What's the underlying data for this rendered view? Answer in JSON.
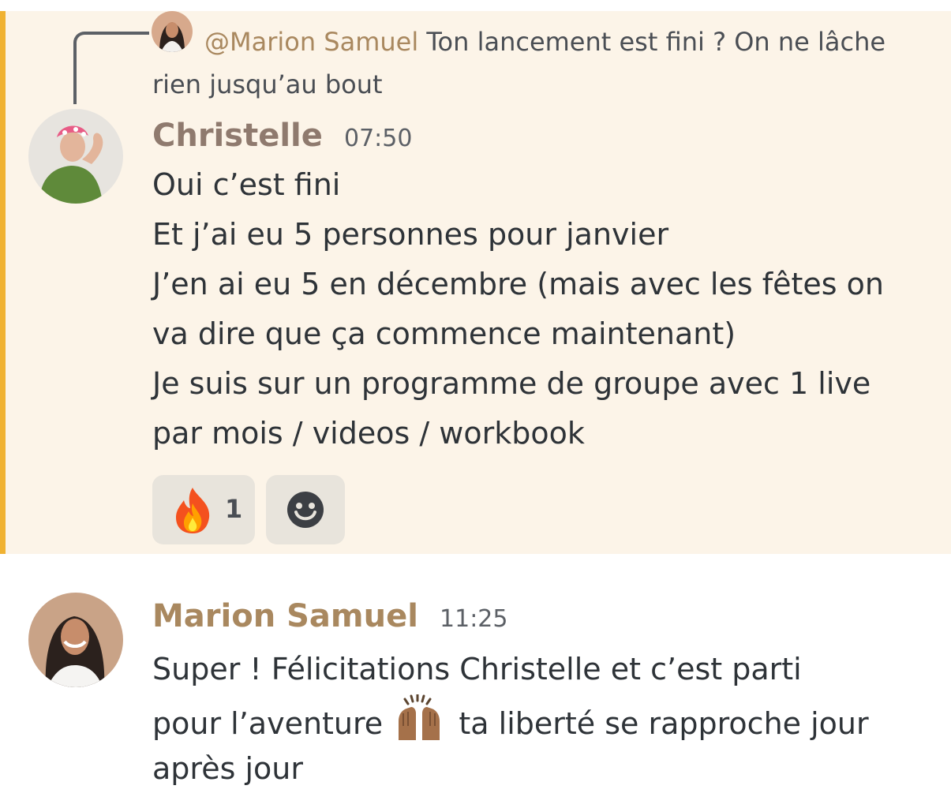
{
  "highlighted_message": {
    "reply_preview": {
      "mention": "@Marion Samuel",
      "text": "Ton lancement est fini ? On ne lâche rien jusqu’au bout"
    },
    "author": "Christelle",
    "author_color": "#8f7a6e",
    "timestamp": "07:50",
    "lines": [
      "Oui c’est fini",
      "Et j’ai eu 5 personnes pour janvier",
      "J’en ai eu 5 en décembre (mais avec les fêtes on",
      "va dire que ça commence maintenant)",
      "Je suis sur un programme de groupe avec 1 live",
      "par mois / videos / workbook"
    ],
    "reactions": [
      {
        "emoji": "fire-emoji",
        "count": "1"
      }
    ],
    "add_reaction_icon": "smiley-add-reaction-icon"
  },
  "second_message": {
    "author": "Marion Samuel",
    "author_color": "#a9885f",
    "timestamp": "11:25",
    "line1": "Super ! Félicitations Christelle et c’est parti",
    "line2_before": "pour l’aventure",
    "line2_emoji": "raising-hands-emoji",
    "line2_after": "ta liberté se rapproche jour",
    "line3": "après jour"
  },
  "colors": {
    "highlight_background": "#fcf4e8",
    "highlight_bar": "#f0b232",
    "mention": "#a9885f"
  }
}
